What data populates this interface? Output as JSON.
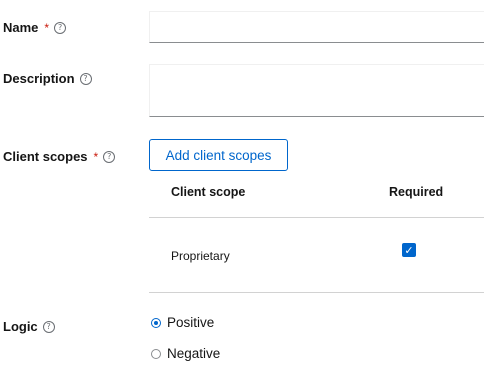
{
  "form": {
    "name": {
      "label": "Name",
      "required_mark": "*",
      "value": "",
      "placeholder": ""
    },
    "description": {
      "label": "Description",
      "value": "",
      "placeholder": ""
    },
    "client_scopes": {
      "label": "Client scopes",
      "required_mark": "*",
      "add_button_label": "Add client scopes",
      "table": {
        "headers": [
          "Client scope",
          "Required"
        ],
        "rows": [
          {
            "client_scope": "Proprietary",
            "required": true
          }
        ]
      }
    },
    "logic": {
      "label": "Logic",
      "options": [
        {
          "label": "Positive",
          "selected": true
        },
        {
          "label": "Negative",
          "selected": false
        }
      ]
    }
  },
  "icons": {
    "help": "help-circle-icon",
    "check": "checkmark-icon"
  },
  "colors": {
    "accent": "#0066cc",
    "required": "#c9190b",
    "border": "#8a8d90",
    "divider": "#d2d2d2"
  }
}
